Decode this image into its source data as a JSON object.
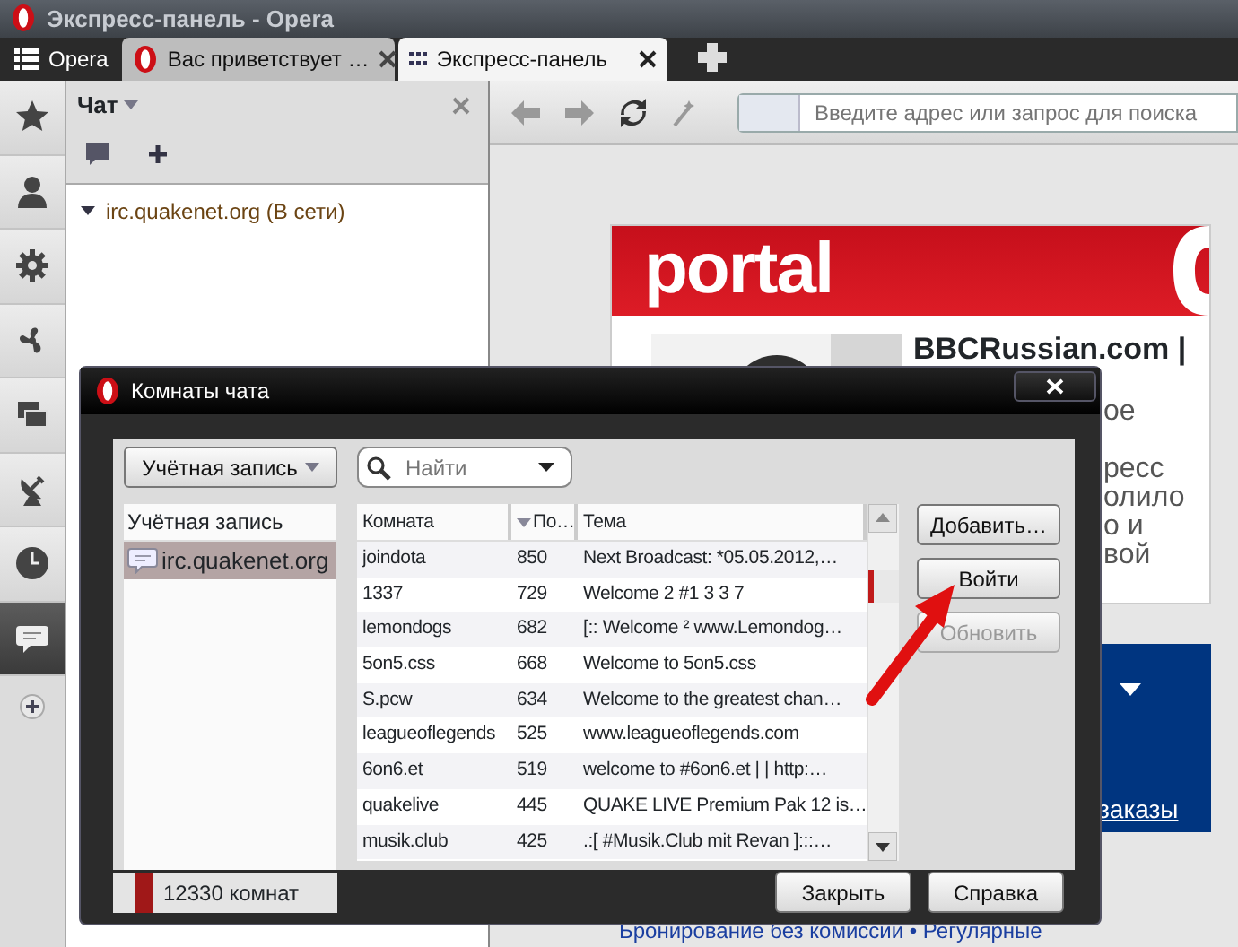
{
  "window": {
    "title": "Экспресс-панель - Opera"
  },
  "menu_button": {
    "label": "Opera"
  },
  "tabs": [
    {
      "kind": "page",
      "label": "Вас приветствует …",
      "selected": false
    },
    {
      "kind": "speeddial",
      "label": "Экспресс-панель",
      "selected": true
    }
  ],
  "panels": [
    {
      "kind": "star",
      "selected": false
    },
    {
      "kind": "person",
      "selected": false
    },
    {
      "kind": "gear",
      "selected": false
    },
    {
      "kind": "fan",
      "selected": false
    },
    {
      "kind": "windows",
      "selected": false
    },
    {
      "kind": "dish",
      "selected": false
    },
    {
      "kind": "clock",
      "selected": false
    },
    {
      "kind": "chat",
      "selected": true
    }
  ],
  "chat_panel": {
    "title": "Чат",
    "tree": [
      {
        "label": "irc.quakenet.org (В сети)",
        "expanded": true
      }
    ]
  },
  "address_bar": {
    "placeholder": "Введите адрес или запрос для поиска"
  },
  "page": {
    "logo": "portal",
    "headline": "BBCRussian.com |",
    "fragments": [
      "ое",
      "ресс",
      "олило",
      "о и",
      "вой"
    ],
    "banner_link": "заказы",
    "footer_link": "Бронирование без комиссии • Регулярные"
  },
  "dialog": {
    "title": "Комнаты чата",
    "account_button": "Учётная запись",
    "search": {
      "placeholder": "Найти"
    },
    "accounts": {
      "column": "Учётная запись",
      "items": [
        {
          "label": "irc.quakenet.org",
          "selected": true
        }
      ]
    },
    "rooms": {
      "columns": [
        {
          "label": "Комната",
          "sorted": false
        },
        {
          "label": "По…",
          "sorted": true
        },
        {
          "label": "Тема",
          "sorted": false
        }
      ],
      "rows": [
        [
          "joindota",
          "850",
          "Next Broadcast: *05.05.2012,…"
        ],
        [
          "1337",
          "729",
          "Welcome 2 #1 3 3 7"
        ],
        [
          "lemondogs",
          "682",
          "[:: Welcome ² www.Lemondog…"
        ],
        [
          "5on5.css",
          "668",
          "Welcome to 5on5.css"
        ],
        [
          "S.pcw",
          "634",
          "Welcome to the greatest chan…"
        ],
        [
          "leagueoflegends",
          "525",
          "www.leagueoflegends.com"
        ],
        [
          "6on6.et",
          "519",
          "welcome to #6on6.et | | http:…"
        ],
        [
          "quakelive",
          "445",
          "QUAKE LIVE Premium Pak 12 is…"
        ],
        [
          "musik.club",
          "425",
          ".:[ #Musik.Club mit Revan ]:::…"
        ]
      ]
    },
    "side_buttons": [
      {
        "label": "Добавить…",
        "disabled": false
      },
      {
        "label": "Войти",
        "disabled": false
      },
      {
        "label": "Обновить",
        "disabled": true
      }
    ],
    "status": "12330 комнат",
    "buttons": [
      "Закрыть",
      "Справка"
    ]
  }
}
